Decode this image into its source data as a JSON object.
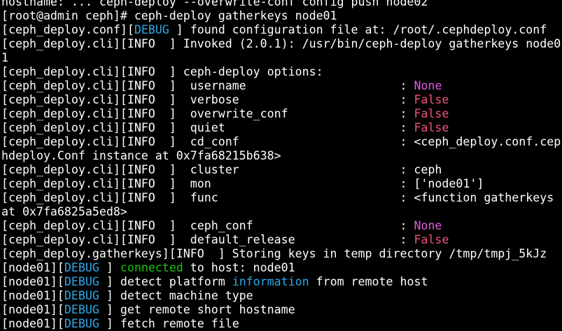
{
  "colors": {
    "background": "#000000",
    "text": "#ffffff",
    "debug": "#2ea8e6",
    "connected": "#16c60c",
    "none": "#e25ce0",
    "false": "#f2537a"
  },
  "lines": [
    [
      {
        "t": "hostname: ... ceph-deploy --overwrite-conf config push node02",
        "c": "white"
      }
    ],
    [
      {
        "t": "[root@admin ceph]# ceph-deploy gatherkeys node01",
        "c": "white"
      }
    ],
    [
      {
        "t": "[ceph_deploy.conf][",
        "c": "white"
      },
      {
        "t": "DEBUG",
        "c": "blue"
      },
      {
        "t": " ] found configuration file at: /root/.cephdeploy.conf",
        "c": "white"
      }
    ],
    [
      {
        "t": "[ceph_deploy.cli][INFO  ] Invoked (2.0.1): /usr/bin/ceph-deploy gatherkeys node0",
        "c": "white"
      }
    ],
    [
      {
        "t": "1",
        "c": "white"
      }
    ],
    [
      {
        "t": "[ceph_deploy.cli][INFO  ] ceph-deploy options:",
        "c": "white"
      }
    ],
    [
      {
        "t": "[ceph_deploy.cli][INFO  ]  username                      : ",
        "c": "white"
      },
      {
        "t": "None",
        "c": "magenta"
      }
    ],
    [
      {
        "t": "[ceph_deploy.cli][INFO  ]  verbose                       : ",
        "c": "white"
      },
      {
        "t": "False",
        "c": "red"
      }
    ],
    [
      {
        "t": "[ceph_deploy.cli][INFO  ]  overwrite_conf                : ",
        "c": "white"
      },
      {
        "t": "False",
        "c": "red"
      }
    ],
    [
      {
        "t": "[ceph_deploy.cli][INFO  ]  quiet                         : ",
        "c": "white"
      },
      {
        "t": "False",
        "c": "red"
      }
    ],
    [
      {
        "t": "[ceph_deploy.cli][INFO  ]  cd_conf                       : <ceph_deploy.conf.cep",
        "c": "white"
      }
    ],
    [
      {
        "t": "hdeploy.Conf instance at 0x7fa68215b638>",
        "c": "white"
      }
    ],
    [
      {
        "t": "[ceph_deploy.cli][INFO  ]  cluster                       : ceph",
        "c": "white"
      }
    ],
    [
      {
        "t": "[ceph_deploy.cli][INFO  ]  mon                           : ['node01']",
        "c": "white"
      }
    ],
    [
      {
        "t": "[ceph_deploy.cli][INFO  ]  func                          : <function gatherkeys",
        "c": "white"
      }
    ],
    [
      {
        "t": "at 0x7fa6825a5ed8>",
        "c": "white"
      }
    ],
    [
      {
        "t": "[ceph_deploy.cli][INFO  ]  ceph_conf                     : ",
        "c": "white"
      },
      {
        "t": "None",
        "c": "magenta"
      }
    ],
    [
      {
        "t": "[ceph_deploy.cli][INFO  ]  default_release               : ",
        "c": "white"
      },
      {
        "t": "False",
        "c": "red"
      }
    ],
    [
      {
        "t": "[ceph_deploy.gatherkeys][INFO  ] Storing keys in temp directory /tmp/tmpj_5kJz",
        "c": "white"
      }
    ],
    [
      {
        "t": "[node01][",
        "c": "white"
      },
      {
        "t": "DEBUG",
        "c": "blue"
      },
      {
        "t": " ] ",
        "c": "white"
      },
      {
        "t": "connected",
        "c": "green"
      },
      {
        "t": " to host: node01",
        "c": "white"
      }
    ],
    [
      {
        "t": "[node01][",
        "c": "white"
      },
      {
        "t": "DEBUG",
        "c": "blue"
      },
      {
        "t": " ] detect platform ",
        "c": "white"
      },
      {
        "t": "information",
        "c": "blue"
      },
      {
        "t": " from remote host",
        "c": "white"
      }
    ],
    [
      {
        "t": "[node01][",
        "c": "white"
      },
      {
        "t": "DEBUG",
        "c": "blue"
      },
      {
        "t": " ] detect machine type",
        "c": "white"
      }
    ],
    [
      {
        "t": "[node01][",
        "c": "white"
      },
      {
        "t": "DEBUG",
        "c": "blue"
      },
      {
        "t": " ] get remote short hostname",
        "c": "white"
      }
    ],
    [
      {
        "t": "[node01][",
        "c": "white"
      },
      {
        "t": "DEBUG",
        "c": "blue"
      },
      {
        "t": " ] fetch remote file",
        "c": "white"
      }
    ]
  ]
}
